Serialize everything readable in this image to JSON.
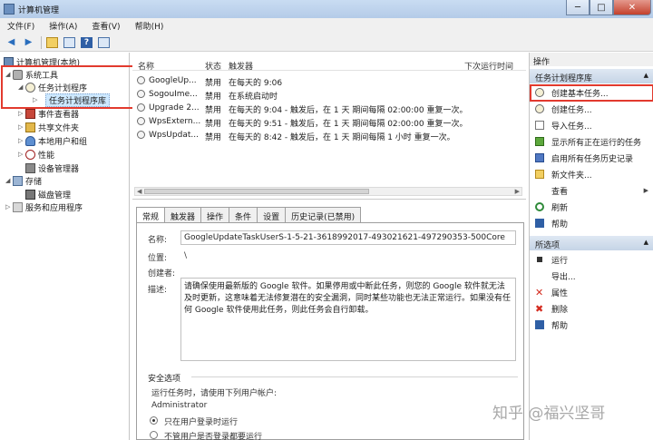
{
  "window": {
    "title": "计算机管理"
  },
  "menu": [
    "文件(F)",
    "操作(A)",
    "查看(V)",
    "帮助(H)"
  ],
  "tree": {
    "root": "计算机管理(本地)",
    "system_tools": "系统工具",
    "task_scheduler": "任务计划程序",
    "task_library": "任务计划程序库",
    "event_viewer": "事件查看器",
    "shared_folders": "共享文件夹",
    "local_users": "本地用户和组",
    "performance": "性能",
    "device_manager": "设备管理器",
    "storage": "存储",
    "disk_management": "磁盘管理",
    "services": "服务和应用程序"
  },
  "task_list": {
    "headers": {
      "name": "名称",
      "status": "状态",
      "trigger": "触发器",
      "next_run": "下次运行时间"
    },
    "rows": [
      {
        "name": "GoogleUp...",
        "status": "禁用",
        "trigger": "在每天的 9:06"
      },
      {
        "name": "SogouIme...",
        "status": "禁用",
        "trigger": "在系统启动时"
      },
      {
        "name": "Upgrade 2...",
        "status": "禁用",
        "trigger": "在每天的 9:04 - 触发后，在 1 天 期间每隔 02:00:00 重复一次。"
      },
      {
        "name": "WpsExtern...",
        "status": "禁用",
        "trigger": "在每天的 9:51 - 触发后，在 1 天 期间每隔 02:00:00 重复一次。"
      },
      {
        "name": "WpsUpdat...",
        "status": "禁用",
        "trigger": "在每天的 8:42 - 触发后，在 1 天 期间每隔 1 小时 重复一次。"
      }
    ]
  },
  "tabs": [
    "常规",
    "触发器",
    "操作",
    "条件",
    "设置",
    "历史记录(已禁用)"
  ],
  "details": {
    "name_label": "名称:",
    "name_value": "GoogleUpdateTaskUserS-1-5-21-3618992017-493021621-497290353-500Core",
    "location_label": "位置:",
    "location_value": "\\",
    "author_label": "创建者:",
    "desc_label": "描述:",
    "description": "请确保使用最新版的 Google 软件。如果停用或中断此任务，则您的 Google 软件就无法及时更新，这意味着无法修复潜在的安全漏洞，同时某些功能也无法正常运行。如果没有任何 Google 软件使用此任务，则此任务会自行卸载。",
    "security_label": "安全选项",
    "run_as_label": "运行任务时，请使用下列用户帐户:",
    "run_as_user": "Administrator",
    "radio1": "只在用户登录时运行",
    "radio2": "不管用户是否登录都要运行"
  },
  "actions": {
    "header": "操作",
    "section1": "任务计划程序库",
    "items1": [
      "创建基本任务...",
      "创建任务...",
      "导入任务...",
      "显示所有正在运行的任务",
      "启用所有任务历史记录",
      "新文件夹...",
      "查看",
      "刷新",
      "帮助"
    ],
    "section2": "所选项",
    "items2": [
      "运行",
      "导出...",
      "属性",
      "删除",
      "帮助"
    ]
  },
  "watermark": "知乎 @福兴坚哥",
  "colors": {
    "highlight": "#e23a2e",
    "selection": "#cde8ff",
    "accent": "#2f5fa5"
  }
}
